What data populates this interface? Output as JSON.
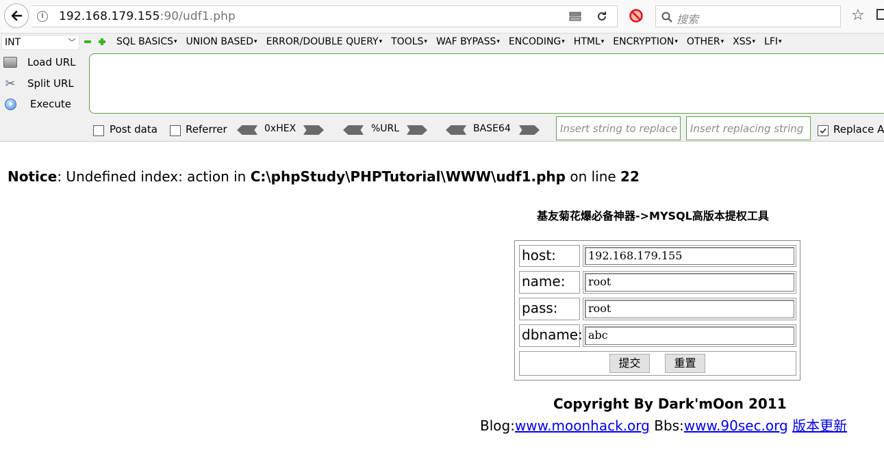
{
  "browser": {
    "url_host": "192.168.179.155",
    "url_rest": ":90/udf1.php",
    "search_placeholder": "搜索"
  },
  "hackbar": {
    "type_select": "INT",
    "menu": [
      "SQL BASICS",
      "UNION BASED",
      "ERROR/DOUBLE QUERY",
      "TOOLS",
      "WAF BYPASS",
      "ENCODING",
      "HTML",
      "ENCRYPTION",
      "OTHER",
      "XSS",
      "LFI"
    ],
    "load_url": "Load URL",
    "split_url": "Split URL",
    "execute": "Execute",
    "post_data": "Post data",
    "referrer": "Referrer",
    "hex": "0xHEX",
    "url_enc": "%URL",
    "base64": "BASE64",
    "replace_ph": "Insert string to replace",
    "replacing_ph": "Insert replacing string",
    "replace_all": "Replace All",
    "replace_all_checked": true
  },
  "notice": {
    "label": "Notice",
    "msg": ": Undefined index: action in ",
    "path": "C:\\phpStudy\\PHPTutorial\\WWW\\udf1.php",
    "on_line": " on line ",
    "line": "22"
  },
  "page": {
    "title": "基友菊花爆必备神器->MYSQL高版本提权工具",
    "fields": [
      {
        "label": "host:",
        "value": "192.168.179.155"
      },
      {
        "label": "name:",
        "value": "root"
      },
      {
        "label": "pass:",
        "value": "root"
      },
      {
        "label": "dbname:",
        "value": "abc"
      }
    ],
    "submit": "提交",
    "reset": "重置",
    "copyright": "Copyright By Dark'mOon 2011",
    "blog_label": "Blog:",
    "blog_link": "www.moonhack.org",
    "bbs_label": " Bbs:",
    "bbs_link": "www.90sec.org",
    "update_link": "版本更新"
  }
}
